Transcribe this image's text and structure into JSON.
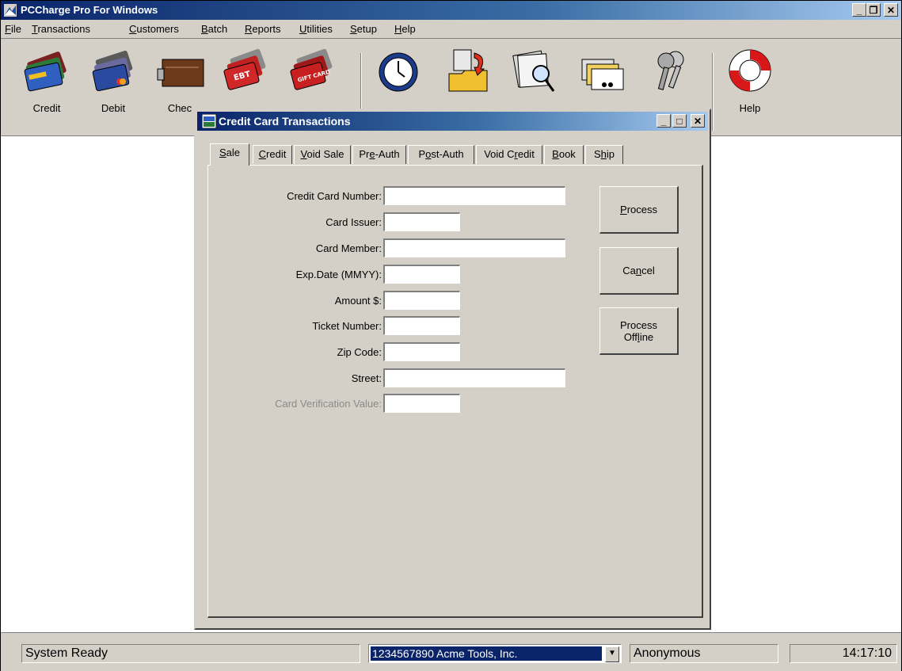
{
  "app": {
    "title": "PCCharge Pro For Windows",
    "menu": [
      {
        "pre": "",
        "key": "F",
        "post": "ile"
      },
      {
        "pre": "",
        "key": "T",
        "post": "ransactions"
      },
      {
        "pre": "",
        "key": "C",
        "post": "ustomers"
      },
      {
        "pre": "",
        "key": "B",
        "post": "atch"
      },
      {
        "pre": "",
        "key": "R",
        "post": "eports"
      },
      {
        "pre": "",
        "key": "U",
        "post": "tilities"
      },
      {
        "pre": "",
        "key": "S",
        "post": "etup"
      },
      {
        "pre": "",
        "key": "H",
        "post": "elp"
      }
    ],
    "toolbar": [
      {
        "label": "Credit",
        "icon": "credit-cards-icon"
      },
      {
        "label": "Debit",
        "icon": "bankcards-icon"
      },
      {
        "label": "Chec",
        "icon": "checkbook-icon"
      },
      {
        "label": "",
        "icon": "ebt-cards-icon"
      },
      {
        "label": "",
        "icon": "gift-cards-icon"
      },
      {
        "label": "",
        "icon": "clock-icon"
      },
      {
        "label": "",
        "icon": "folder-batch-icon"
      },
      {
        "label": "",
        "icon": "report-magnifier-icon"
      },
      {
        "label": "",
        "icon": "card-files-icon"
      },
      {
        "label": "",
        "icon": "keys-icon"
      },
      {
        "label": "Help",
        "icon": "lifebuoy-icon"
      }
    ]
  },
  "dialog": {
    "title": "Credit Card Transactions",
    "tabs": [
      {
        "pre": "",
        "key": "S",
        "post": "ale"
      },
      {
        "pre": "",
        "key": "C",
        "post": "redit"
      },
      {
        "pre": "",
        "key": "V",
        "post": "oid Sale"
      },
      {
        "pre": "Pr",
        "key": "e",
        "post": "-Auth"
      },
      {
        "pre": "P",
        "key": "o",
        "post": "st-Auth"
      },
      {
        "pre": "Void C",
        "key": "r",
        "post": "edit"
      },
      {
        "pre": "",
        "key": "B",
        "post": "ook"
      },
      {
        "pre": "S",
        "key": "h",
        "post": "ip"
      }
    ],
    "fields": {
      "card_number": {
        "label": "Credit Card Number:",
        "value": ""
      },
      "card_issuer": {
        "label": "Card Issuer:",
        "value": ""
      },
      "card_member": {
        "label": "Card Member:",
        "value": ""
      },
      "exp_date": {
        "label": "Exp.Date (MMYY):",
        "value": ""
      },
      "amount": {
        "label": "Amount $:",
        "value": ""
      },
      "ticket_number": {
        "label": "Ticket Number:",
        "value": ""
      },
      "zip_code": {
        "label": "Zip Code:",
        "value": ""
      },
      "street": {
        "label": "Street:",
        "value": ""
      },
      "cvv": {
        "label": "Card Verification Value:",
        "value": ""
      }
    },
    "buttons": {
      "process": {
        "pre": "",
        "key": "P",
        "post": "rocess"
      },
      "cancel": {
        "pre": "Ca",
        "key": "n",
        "post": "cel"
      },
      "offline_line1": "Process",
      "offline_line2": {
        "pre": "Off",
        "key": "l",
        "post": "ine"
      }
    }
  },
  "status": {
    "message": "System Ready",
    "merchant_selected": "1234567890  Acme Tools, Inc.",
    "user": "Anonymous",
    "time": "14:17:10"
  }
}
